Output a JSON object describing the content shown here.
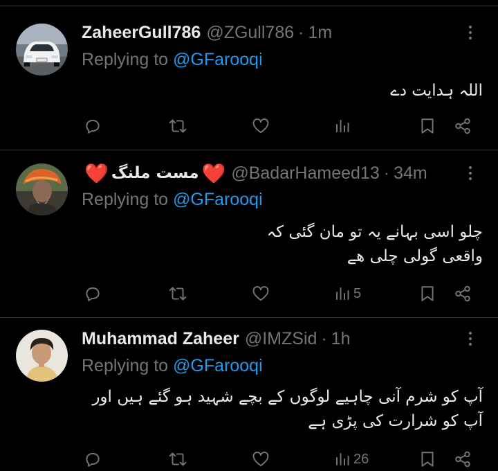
{
  "tweets": [
    {
      "name": "ZaheerGull786",
      "name_prefix_heart": "",
      "name_suffix_heart": "",
      "handle": "@ZGull786",
      "time": "1m",
      "reply_prefix": "Replying to",
      "reply_to": "@GFarooqi",
      "body_lines": [
        "اللہ ہدایت دے"
      ],
      "views": ""
    },
    {
      "name": "مست ملنگ",
      "name_prefix_heart": "❤️",
      "name_suffix_heart": "❤️",
      "handle": "@BadarHameed13",
      "time": "34m",
      "reply_prefix": "Replying to",
      "reply_to": "@GFarooqi",
      "body_lines": [
        "چلو اسی بہانے یہ تو مان گئی کہ",
        "واقعی گولی چلی ھے"
      ],
      "views": "5"
    },
    {
      "name": "Muhammad Zaheer",
      "name_prefix_heart": "",
      "name_suffix_heart": "",
      "handle": "@IMZSid",
      "time": "1h",
      "reply_prefix": "Replying to",
      "reply_to": "@GFarooqi",
      "body_lines": [
        "آپ کو شرم آنی چاہیے لوگوں کے بچے شہید ہو گئے ہیں اور",
        "آپ کو شرارت کی پڑی ہے"
      ],
      "views": "26"
    }
  ],
  "separator": "·",
  "icons": {
    "reply": "reply-icon",
    "retweet": "retweet-icon",
    "like": "like-icon",
    "views": "views-icon",
    "bookmark": "bookmark-icon",
    "share": "share-icon",
    "more": "more-options-icon"
  },
  "colors": {
    "background": "#000000",
    "text": "#e7e9ea",
    "muted": "#71767b",
    "link": "#1d9bf0",
    "heart": "#f0243a",
    "divider": "#2f3336"
  }
}
